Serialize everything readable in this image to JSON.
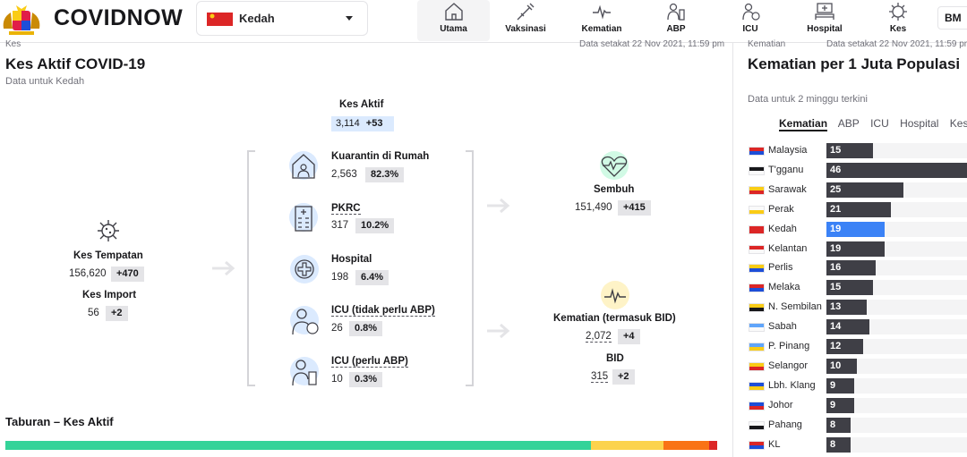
{
  "header": {
    "brand": "COVIDNOW",
    "state": "Kedah",
    "lang": "BM",
    "nav": [
      {
        "label": "Utama",
        "icon": "home-icon",
        "active": true
      },
      {
        "label": "Vaksinasi",
        "icon": "syringe-icon",
        "active": false
      },
      {
        "label": "Kematian",
        "icon": "heartbeat-icon",
        "active": false
      },
      {
        "label": "ABP",
        "icon": "ventilator-icon",
        "active": false
      },
      {
        "label": "ICU",
        "icon": "icu-icon",
        "active": false
      },
      {
        "label": "Hospital",
        "icon": "hospital-bed-icon",
        "active": false
      },
      {
        "label": "Kes",
        "icon": "virus-icon",
        "active": false
      }
    ]
  },
  "main": {
    "cut_label": "Kes",
    "stamp": "Data setakat 22 Nov 2021, 11:59 pm",
    "title": "Kes Aktif COVID-19",
    "subtitle": "Data untuk Kedah",
    "kes_aktif": {
      "label": "Kes Aktif",
      "value": "3,114",
      "delta": "+53"
    },
    "tempatan": {
      "label": "Kes Tempatan",
      "value": "156,620",
      "delta": "+470"
    },
    "import": {
      "label": "Kes Import",
      "value": "56",
      "delta": "+2"
    },
    "categories": [
      {
        "label": "Kuarantin di Rumah",
        "value": "2,563",
        "pct": "82.3%"
      },
      {
        "label": "PKRC",
        "value": "317",
        "pct": "10.2%"
      },
      {
        "label": "Hospital",
        "value": "198",
        "pct": "6.4%"
      },
      {
        "label": "ICU (tidak perlu ABP)",
        "value": "26",
        "pct": "0.8%"
      },
      {
        "label": "ICU (perlu ABP)",
        "value": "10",
        "pct": "0.3%"
      }
    ],
    "sembuh": {
      "label": "Sembuh",
      "value": "151,490",
      "delta": "+415"
    },
    "kematian": {
      "label": "Kematian (termasuk BID)",
      "value": "2,072",
      "delta": "+4"
    },
    "bid": {
      "label": "BID",
      "value": "315",
      "delta": "+2"
    },
    "distribution_title": "Taburan – Kes Aktif",
    "distribution": [
      {
        "name": "Kuarantin di Rumah",
        "pct": 82.3,
        "color": "#34d399"
      },
      {
        "name": "PKRC",
        "pct": 10.2,
        "color": "#fcd34d"
      },
      {
        "name": "Hospital",
        "pct": 6.4,
        "color": "#f97316"
      },
      {
        "name": "ICU",
        "pct": 1.1,
        "color": "#dc2626"
      }
    ]
  },
  "side": {
    "cut_label": "Kematian",
    "stamp": "Data setakat 22 Nov 2021, 11:59 pm",
    "title": "Kematian per 1 Juta Populasi",
    "subtitle": "Data untuk 2 minggu terkini",
    "tabs": [
      "Kematian",
      "ABP",
      "ICU",
      "Hospital",
      "Kes"
    ],
    "max": 46,
    "rows": [
      {
        "state": "Malaysia",
        "value": 15,
        "highlight": false
      },
      {
        "state": "T'gganu",
        "value": 46,
        "highlight": false
      },
      {
        "state": "Sarawak",
        "value": 25,
        "highlight": false
      },
      {
        "state": "Perak",
        "value": 21,
        "highlight": false
      },
      {
        "state": "Kedah",
        "value": 19,
        "highlight": true
      },
      {
        "state": "Kelantan",
        "value": 19,
        "highlight": false
      },
      {
        "state": "Perlis",
        "value": 16,
        "highlight": false
      },
      {
        "state": "Melaka",
        "value": 15,
        "highlight": false
      },
      {
        "state": "N. Sembilan",
        "value": 13,
        "highlight": false
      },
      {
        "state": "Sabah",
        "value": 14,
        "highlight": false
      },
      {
        "state": "P. Pinang",
        "value": 12,
        "highlight": false
      },
      {
        "state": "Selangor",
        "value": 10,
        "highlight": false
      },
      {
        "state": "Lbh. Klang",
        "value": 9,
        "highlight": false
      },
      {
        "state": "Johor",
        "value": 9,
        "highlight": false
      },
      {
        "state": "Pahang",
        "value": 8,
        "highlight": false
      },
      {
        "state": "KL",
        "value": 8,
        "highlight": false
      }
    ]
  }
}
